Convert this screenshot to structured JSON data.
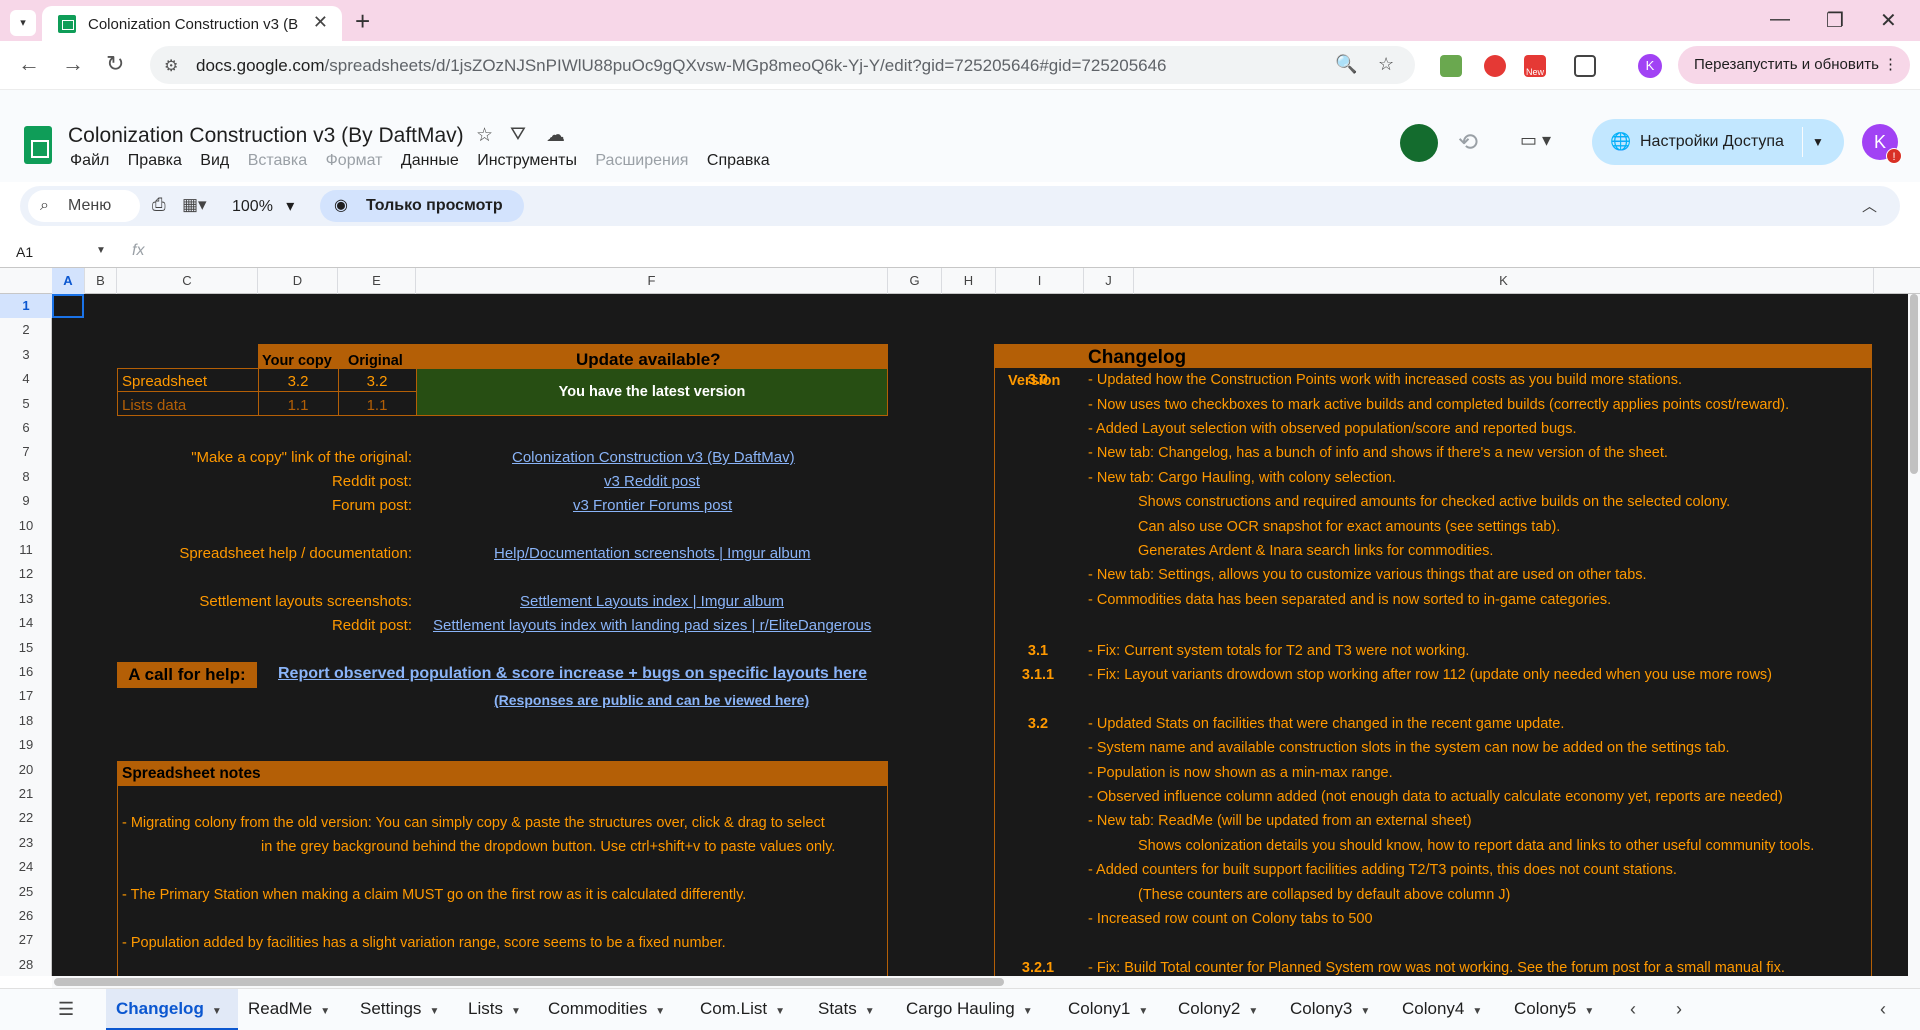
{
  "browser": {
    "tab_title": "Colonization Construction v3 (B",
    "new_tab": "+",
    "url_domain": "docs.google.com",
    "url_path": "/spreadsheets/d/1jsZOzNJSnPIWlU88puOc9gQXvsw-MGp8meoQ6k-Yj-Y/edit?gid=725205646#gid=725205646",
    "relaunch_label": "Перезапустить и обновить",
    "profile_letter": "K",
    "ext_new_badge": "New"
  },
  "sheets": {
    "doc_title": "Colonization Construction v3 (By DaftMav)",
    "menu": [
      "Файл",
      "Правка",
      "Вид",
      "Вставка",
      "Формат",
      "Данные",
      "Инструменты",
      "Расширения",
      "Справка"
    ],
    "menu_disabled": [
      false,
      false,
      false,
      true,
      true,
      false,
      false,
      true,
      false
    ],
    "share_label": "Настройки Доступа",
    "avatar_letter": "K",
    "toolbar": {
      "menu_search": "Меню",
      "zoom": "100%",
      "view_only": "Только просмотр"
    },
    "name_box": "A1",
    "fx": "fx"
  },
  "grid": {
    "columns": [
      "A",
      "B",
      "C",
      "D",
      "E",
      "F",
      "G",
      "H",
      "I",
      "J",
      "K"
    ],
    "rows": [
      "1",
      "2",
      "3",
      "4",
      "5",
      "6",
      "7",
      "8",
      "9",
      "10",
      "11",
      "12",
      "13",
      "14",
      "15",
      "16",
      "17",
      "18",
      "19",
      "20",
      "21",
      "22",
      "23",
      "24",
      "25",
      "26",
      "27",
      "28"
    ]
  },
  "version_box": {
    "col_your_copy": "Your copy",
    "col_original": "Original",
    "update_title": "Update available?",
    "rows": [
      {
        "label": "Spreadsheet",
        "your": "3.2",
        "orig": "3.2"
      },
      {
        "label": "Lists data",
        "your": "1.1",
        "orig": "1.1"
      }
    ],
    "status": "You have the latest version"
  },
  "links": {
    "copy_label": "\"Make a copy\" link of the original:",
    "copy_link": "Colonization Construction v3 (By DaftMav)",
    "reddit_label": "Reddit post:",
    "reddit_link": "v3 Reddit post",
    "forum_label": "Forum post:",
    "forum_link": "v3 Frontier Forums post",
    "help_label": "Spreadsheet help / documentation:",
    "help_link": "Help/Documentation screenshots | Imgur album",
    "layouts_label": "Settlement layouts screenshots:",
    "layouts_link": "Settlement Layouts index | Imgur album",
    "layouts_reddit_label": "Reddit post:",
    "layouts_reddit_link": "Settlement layouts index with landing pad sizes | r/EliteDangerous"
  },
  "call_for_help": {
    "badge": "A call for help:",
    "link": "Report observed population & score increase + bugs on specific layouts here",
    "sub_link": "(Responses are public and can be viewed here)"
  },
  "notes": {
    "title": "Spreadsheet notes",
    "lines": [
      "- Migrating colony from the old version: You can simply copy & paste the structures over, click & drag to select",
      "in the grey background behind the dropdown button. Use ctrl+shift+v to paste values only.",
      "- The Primary Station when making a claim MUST go on the first row as it is calculated differently.",
      "- Population added by facilities has a slight variation range, score seems to be a fixed number."
    ]
  },
  "changelog": {
    "title": "Changelog",
    "version_header": "Version",
    "entries": [
      {
        "v": "3.0",
        "text": "- Updated how the Construction Points work with increased costs as you build more stations."
      },
      {
        "v": "",
        "text": "- Now uses two checkboxes to mark active builds and completed builds (correctly applies points cost/reward)."
      },
      {
        "v": "",
        "text": "- Added Layout selection with observed population/score and reported bugs."
      },
      {
        "v": "",
        "text": "- New tab: Changelog, has a bunch of info and shows if there's a new version of the sheet."
      },
      {
        "v": "",
        "text": "- New tab: Cargo Hauling, with colony selection."
      },
      {
        "v": "",
        "text": "Shows constructions and required amounts for checked active builds on the selected colony.",
        "indent": true
      },
      {
        "v": "",
        "text": "Can also use OCR snapshot for exact amounts (see settings tab).",
        "indent": true
      },
      {
        "v": "",
        "text": "Generates Ardent & Inara search links for commodities.",
        "indent": true
      },
      {
        "v": "",
        "text": "- New tab: Settings, allows you to customize various things that are used on other tabs."
      },
      {
        "v": "",
        "text": "- Commodities data has been separated and is now sorted to in-game categories."
      },
      {
        "v": "3.1",
        "text": "- Fix: Current system totals for T2 and T3 were not working."
      },
      {
        "v": "3.1.1",
        "text": "- Fix: Layout variants drowdown stop working after row 112 (update only needed when you use more rows)"
      },
      {
        "v": "3.2",
        "text": "- Updated Stats on facilities that were changed in the recent game update."
      },
      {
        "v": "",
        "text": "- System name and available construction slots in the system can now be added on the settings tab."
      },
      {
        "v": "",
        "text": "- Population is now shown as a min-max range."
      },
      {
        "v": "",
        "text": "- Observed influence column added (not enough data to actually calculate economy yet, reports are needed)"
      },
      {
        "v": "",
        "text": "- New tab: ReadMe  (will be updated from an external sheet)"
      },
      {
        "v": "",
        "text": "Shows colonization details you should know, how to report data and links to other useful community tools.",
        "indent": true
      },
      {
        "v": "",
        "text": "- Added counters for built support facilities adding T2/T3 points, this does not count stations."
      },
      {
        "v": "",
        "text": "(These counters are collapsed by default above column J)",
        "indent": true
      },
      {
        "v": "",
        "text": "- Increased row count on Colony tabs to 500"
      },
      {
        "v": "3.2.1",
        "text": "- Fix: Build Total counter for Planned System row was not working. See the forum post for a small manual fix."
      }
    ]
  },
  "sheet_tabs": [
    "Changelog",
    "ReadMe",
    "Settings",
    "Lists",
    "Commodities",
    "Com.List",
    "Stats",
    "Cargo Hauling",
    "Colony1",
    "Colony2",
    "Colony3",
    "Colony4",
    "Colony5"
  ],
  "active_sheet": "Changelog",
  "colors": {
    "grid_bg": "#191919",
    "orange_text": "#ff9900",
    "header_orange": "#b45f06",
    "green_status": "#274e13",
    "link_blue": "#8ab4f8"
  }
}
